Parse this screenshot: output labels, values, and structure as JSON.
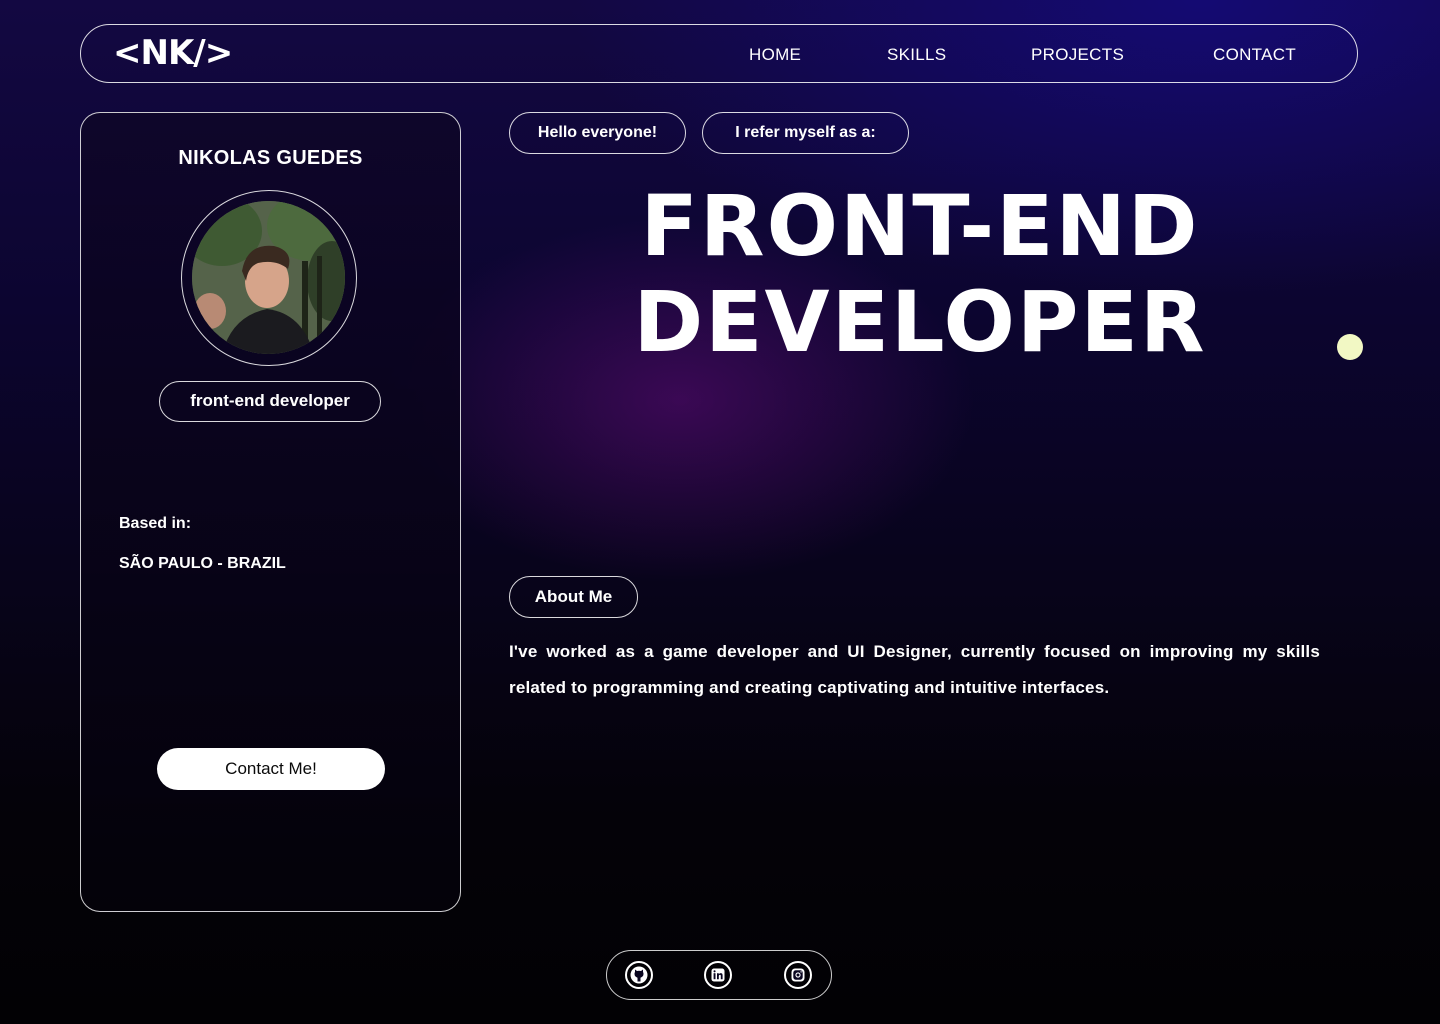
{
  "navbar": {
    "logo": "<NK/>",
    "links": [
      "HOME",
      "SKILLS",
      "PROJECTS",
      "CONTACT"
    ]
  },
  "profile": {
    "name": "NIKOLAS GUEDES",
    "role": "front-end developer",
    "based_label": "Based in:",
    "location": "SÃO PAULO - BRAZIL",
    "contact_button": "Contact Me!"
  },
  "hero": {
    "tags": [
      "Hello everyone!",
      "I refer myself as a:"
    ],
    "headline_line1": "FRONT-END",
    "headline_line2": "DEVELOPER"
  },
  "about": {
    "label": "About Me",
    "text": "I've worked as a game developer and UI Designer, currently focused on improving my skills related to programming and creating captivating and intuitive interfaces."
  },
  "social": {
    "icons": [
      "github-icon",
      "linkedin-icon",
      "instagram-icon"
    ]
  },
  "colors": {
    "accent_dot": "#f2f8c4",
    "button_bg": "#ffffff"
  }
}
